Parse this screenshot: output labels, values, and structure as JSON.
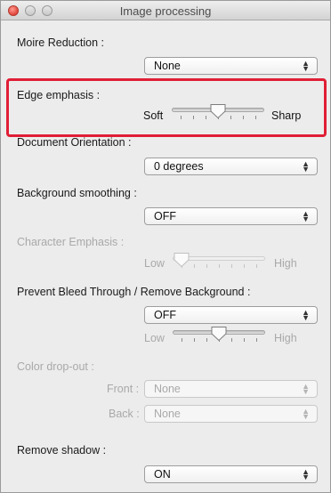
{
  "window": {
    "title": "Image processing"
  },
  "moire_reduction": {
    "label": "Moire Reduction :",
    "value": "None"
  },
  "edge_emphasis": {
    "label": "Edge emphasis :",
    "min_label": "Soft",
    "max_label": "Sharp",
    "level": 0.5
  },
  "document_orientation": {
    "label": "Document Orientation :",
    "value": "0 degrees"
  },
  "background_smoothing": {
    "label": "Background smoothing :",
    "value": "OFF"
  },
  "character_emphasis": {
    "label": "Character Emphasis :",
    "min_label": "Low",
    "max_label": "High",
    "level": 0.0
  },
  "prevent_bleed": {
    "label": "Prevent Bleed Through / Remove Background :",
    "value": "OFF",
    "min_label": "Low",
    "max_label": "High",
    "level": 0.5
  },
  "color_dropout": {
    "label": "Color drop-out :",
    "front_label": "Front :",
    "front_value": "None",
    "back_label": "Back :",
    "back_value": "None"
  },
  "remove_shadow": {
    "label": "Remove shadow :",
    "value": "ON"
  },
  "colors": {
    "highlight": "#e01e35",
    "close": "#e2463c"
  }
}
